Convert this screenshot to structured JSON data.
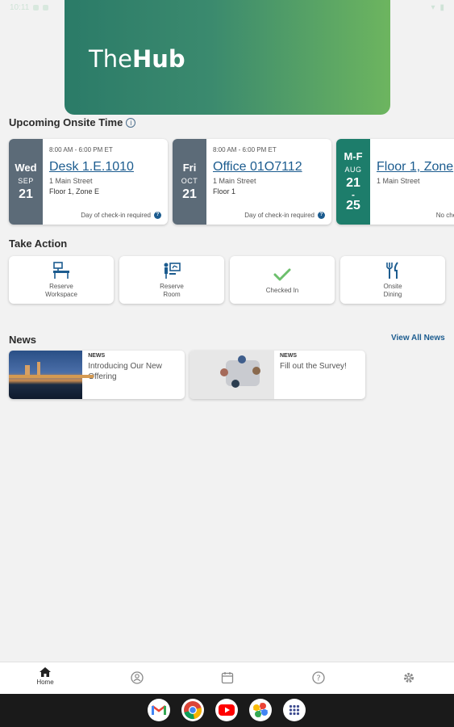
{
  "status_bar": {
    "time": "10:11"
  },
  "hero": {
    "logo_regular": "The",
    "logo_bold": "Hub"
  },
  "upcoming": {
    "title": "Upcoming Onsite Time",
    "cards": [
      {
        "day": "Wed",
        "month": "SEP",
        "date": "21",
        "time": "8:00 AM - 6:00 PM ET",
        "title": "Desk 1.E.1010",
        "address": "1 Main Street",
        "location": "Floor 1, Zone E",
        "footer": "Day of check-in required"
      },
      {
        "day": "Fri",
        "month": "OCT",
        "date": "21",
        "time": "8:00 AM - 6:00 PM ET",
        "title": "Office 01O7112",
        "address": "1 Main Street",
        "location": "Floor 1",
        "footer": "Day of check-in required"
      },
      {
        "day": "M-F",
        "month": "AUG",
        "date": "21",
        "dash": "-",
        "date_end": "25",
        "time": "",
        "title": "Floor 1, Zone",
        "address": "1 Main Street",
        "location": "",
        "footer": "No check-in"
      }
    ]
  },
  "take_action": {
    "title": "Take Action",
    "items": [
      {
        "label": "Reserve\nWorkspace",
        "icon": "workspace-icon"
      },
      {
        "label": "Reserve\nRoom",
        "icon": "room-icon"
      },
      {
        "label": "Checked In",
        "icon": "checkmark-icon"
      },
      {
        "label": "Onsite\nDining",
        "icon": "dining-icon"
      }
    ]
  },
  "news": {
    "title": "News",
    "view_all": "View All News",
    "items": [
      {
        "category": "NEWS",
        "title": "Introducing Our New Offering"
      },
      {
        "category": "NEWS",
        "title": "Fill out the Survey!"
      }
    ]
  },
  "bottom_nav": {
    "home_label": "Home"
  },
  "colors": {
    "primary_blue": "#1c5c8f",
    "green": "#1d7d6b",
    "slate": "#5c6b78",
    "check_green": "#6cbf6c"
  }
}
